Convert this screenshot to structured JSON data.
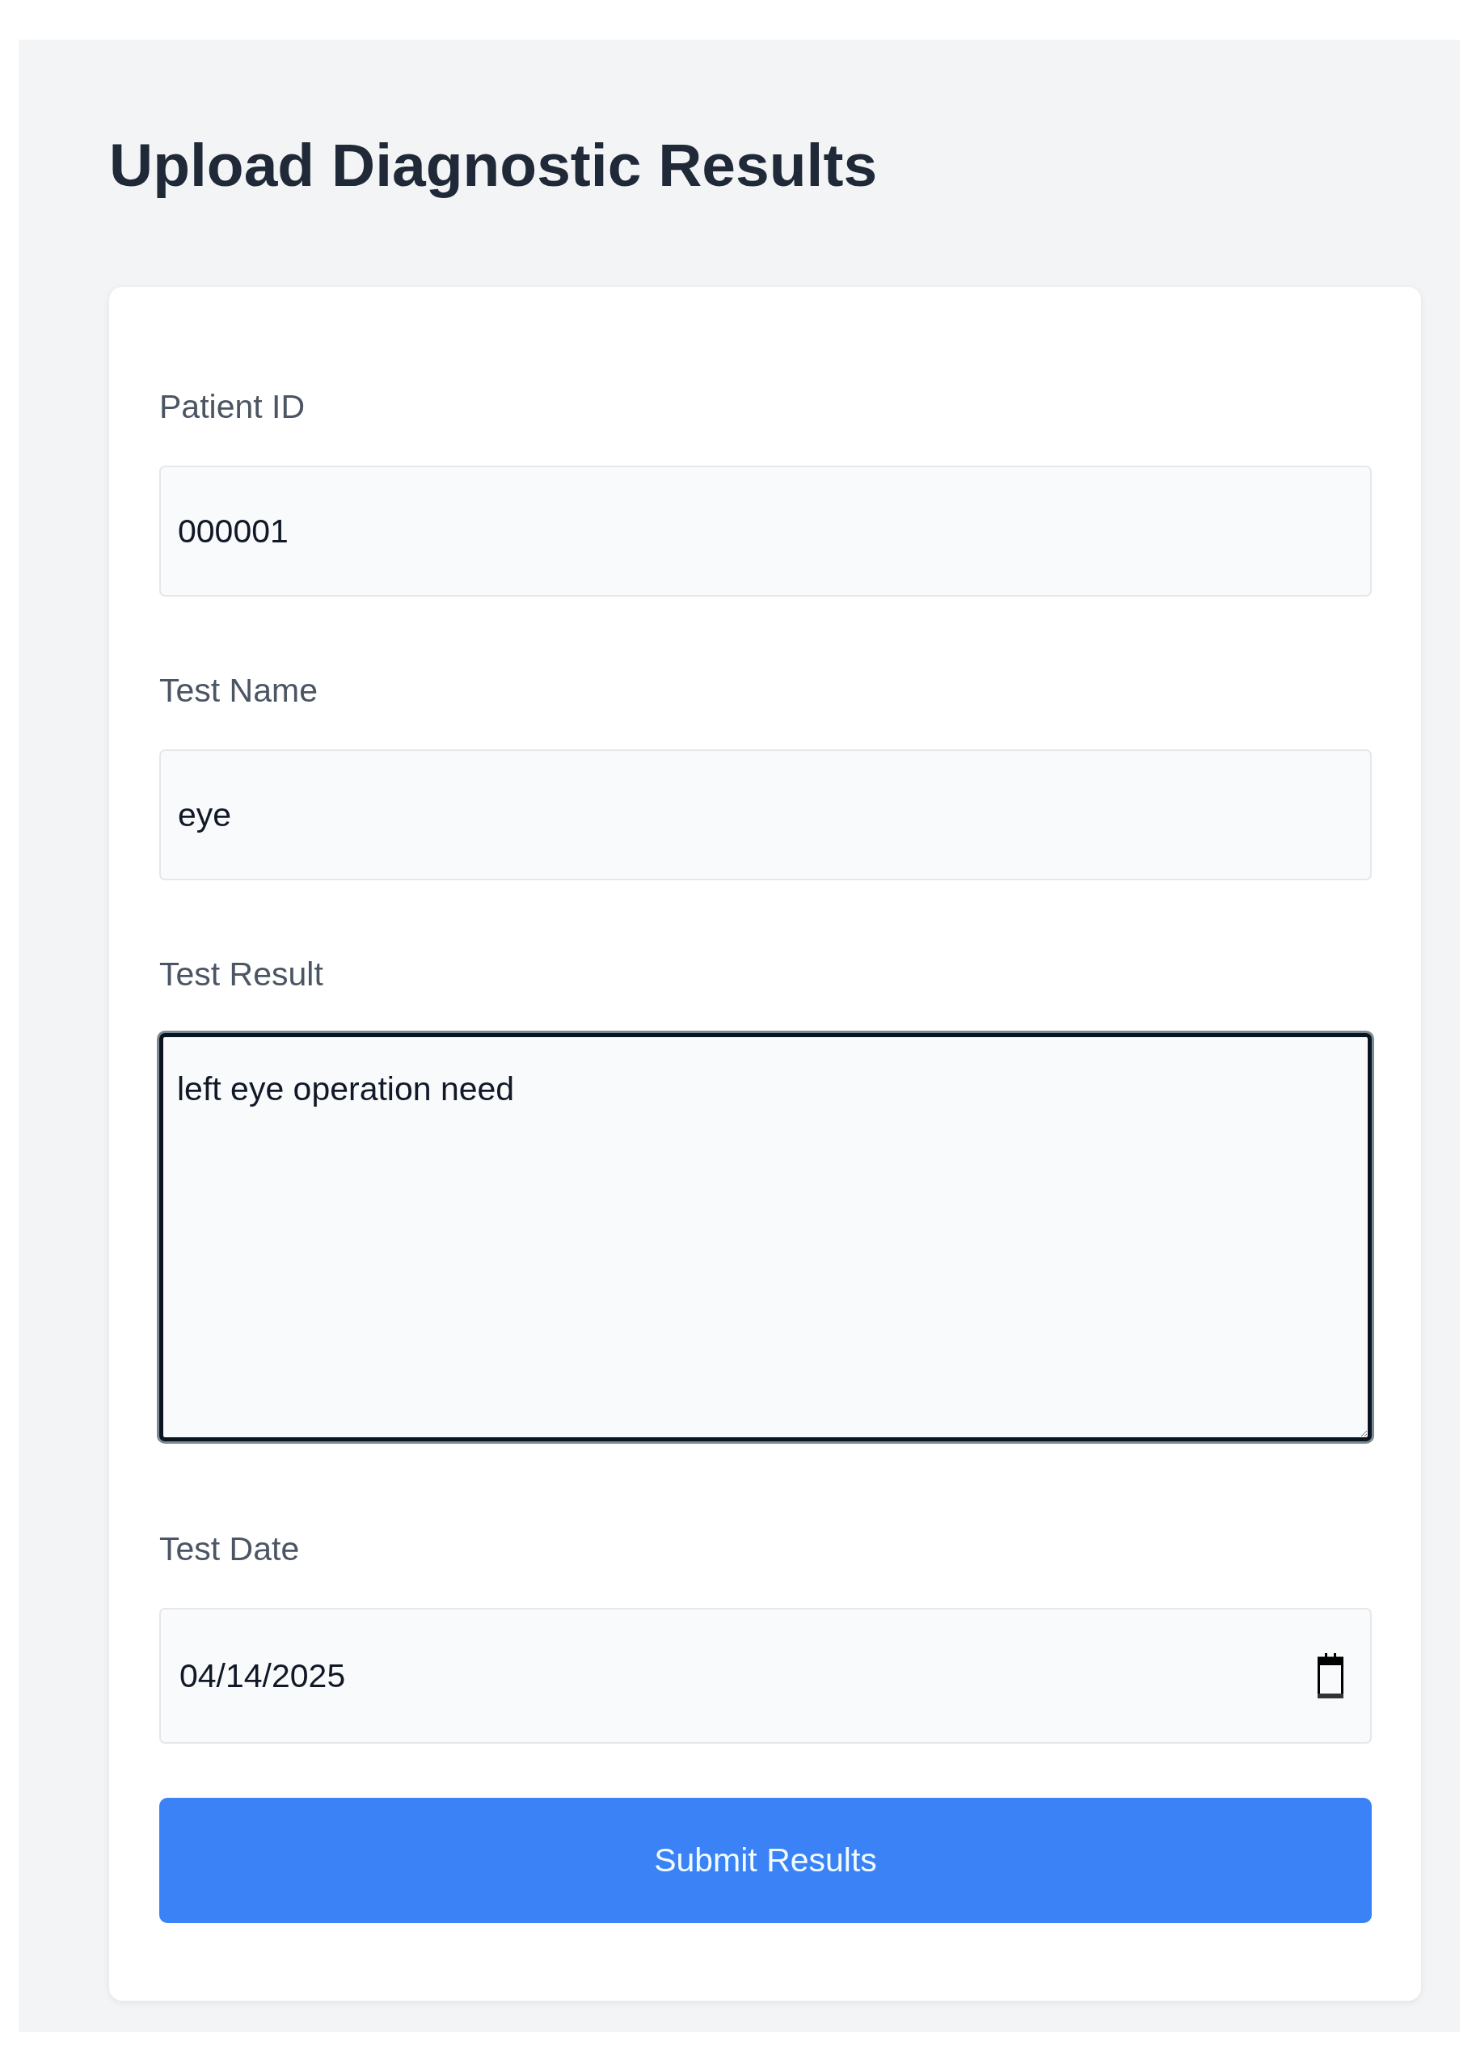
{
  "page": {
    "title": "Upload Diagnostic Results"
  },
  "form": {
    "fields": [
      {
        "kind": "text",
        "label": "Patient ID",
        "value": "000001",
        "focused": false
      },
      {
        "kind": "text",
        "label": "Test Name",
        "value": "eye",
        "focused": false
      },
      {
        "kind": "textarea",
        "label": "Test Result",
        "value": "left eye operation need",
        "focused": true
      },
      {
        "kind": "date",
        "label": "Test Date",
        "value": "04/14/2025",
        "focused": false
      }
    ],
    "submit_button": {
      "label": "Submit Results"
    }
  }
}
